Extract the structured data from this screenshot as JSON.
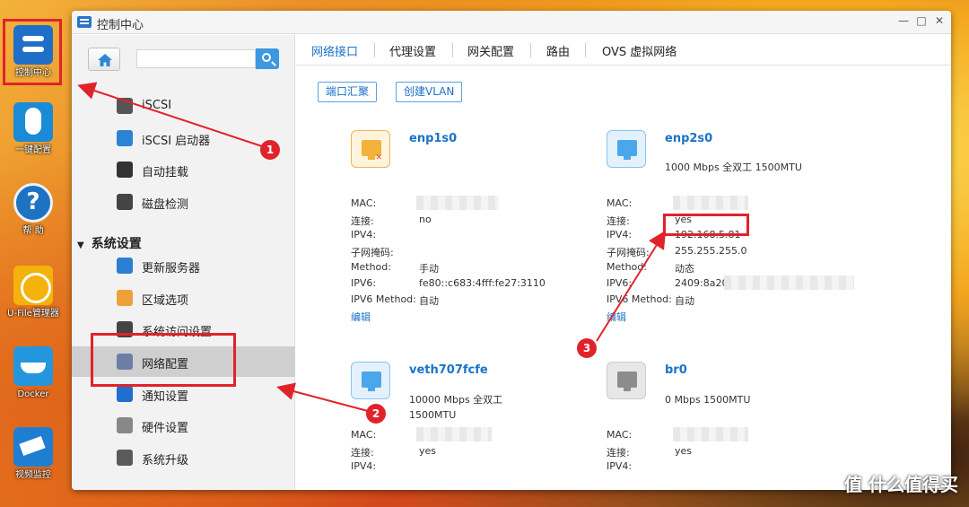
{
  "desktop": {
    "icons": [
      {
        "label": "控制中心",
        "icon": "control-center-icon"
      },
      {
        "label": "一键配置",
        "icon": "one-click-config-icon"
      },
      {
        "label": "帮 助",
        "icon": "help-icon"
      },
      {
        "label": "U-File管理器",
        "icon": "ufile-manager-icon"
      },
      {
        "label": "Docker",
        "icon": "docker-icon"
      },
      {
        "label": "视频监控",
        "icon": "video-surveillance-icon"
      }
    ]
  },
  "window": {
    "title": "控制中心",
    "controls": {
      "minimize": "—",
      "maximize": "□",
      "close": "✕"
    }
  },
  "sidebar": {
    "search": {
      "value": "",
      "placeholder": ""
    },
    "items_top": [
      {
        "label": "iSCSI"
      },
      {
        "label": "iSCSI 启动器"
      },
      {
        "label": "自动挂载"
      },
      {
        "label": "磁盘检测"
      }
    ],
    "group": {
      "label": "系统设置"
    },
    "items": [
      {
        "label": "更新服务器"
      },
      {
        "label": "区域选项"
      },
      {
        "label": "系统访问设置"
      },
      {
        "label": "网络配置",
        "active": true
      },
      {
        "label": "通知设置"
      },
      {
        "label": "硬件设置"
      },
      {
        "label": "系统升级"
      }
    ]
  },
  "tabs": [
    {
      "label": "网络接口",
      "active": true
    },
    {
      "label": "代理设置"
    },
    {
      "label": "网关配置"
    },
    {
      "label": "路由"
    },
    {
      "label": "OVS 虚拟网络"
    }
  ],
  "actions": {
    "aggregate": "端口汇聚",
    "create_vlan": "创建VLAN"
  },
  "labels": {
    "mac": "MAC:",
    "link": "连接:",
    "ipv4": "IPV4:",
    "mask": "子网掩码:",
    "method": "Method:",
    "ipv6": "IPV6:",
    "ipv6_method": "IPV6 Method:",
    "edit": "编辑"
  },
  "interfaces": [
    {
      "name": "enp1s0",
      "speed": "",
      "link": "no",
      "ipv4": "",
      "mask": "",
      "method": "手动",
      "ipv6": "fe80::c683:4fff:fe27:3110",
      "ipv6_method": "自动",
      "status": "disconnected"
    },
    {
      "name": "enp2s0",
      "speed": "1000 Mbps 全双工 1500MTU",
      "link": "yes",
      "ipv4": "192.168.5.81",
      "mask": "255.255.255.0",
      "method": "动态",
      "ipv6": "2409:8a20",
      "ipv6_method": "自动",
      "status": "connected"
    },
    {
      "name": "veth707fcfe",
      "speed": "10000 Mbps 全双工",
      "speed2": "1500MTU",
      "link": "yes",
      "status": "connected"
    },
    {
      "name": "br0",
      "speed": "0 Mbps 1500MTU",
      "link": "yes",
      "status": "idle"
    }
  ],
  "annotations": {
    "badge1": "1",
    "badge2": "2",
    "badge3": "3"
  },
  "watermark": "值 什么值得买",
  "colors": {
    "accent": "#1a73c8",
    "annotation": "#e0232b"
  }
}
